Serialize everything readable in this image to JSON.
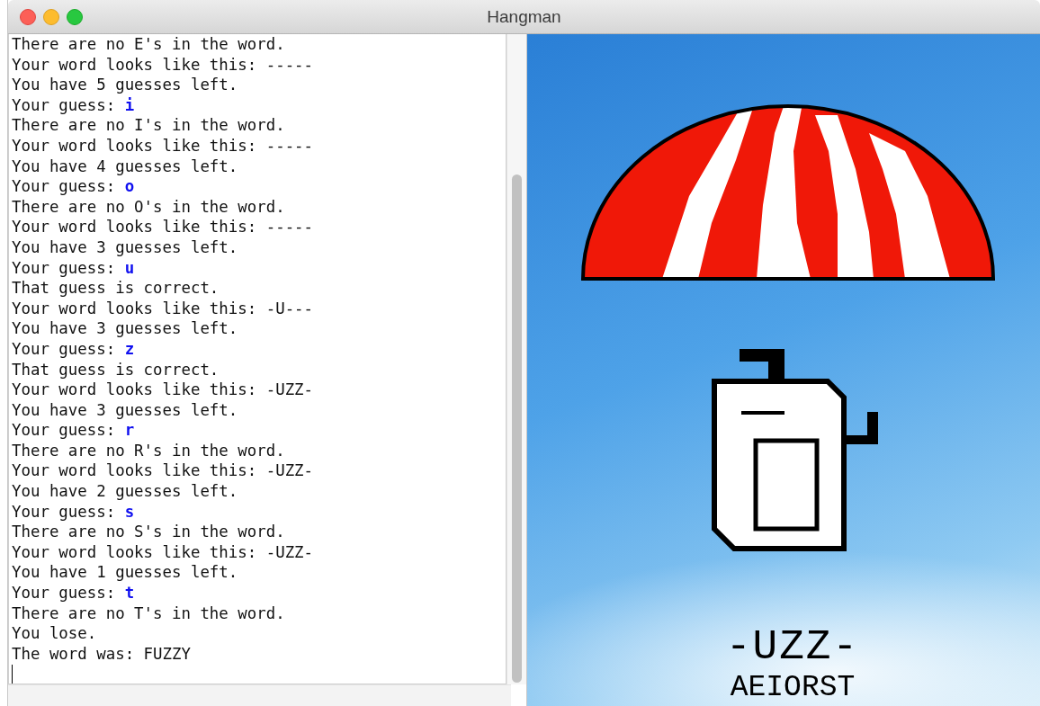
{
  "window": {
    "title": "Hangman"
  },
  "console": {
    "lines": [
      {
        "kind": "text",
        "text": "There are no E's in the word."
      },
      {
        "kind": "text",
        "text": "Your word looks like this: -----"
      },
      {
        "kind": "text",
        "text": "You have 5 guesses left."
      },
      {
        "kind": "guess",
        "prompt": "Your guess:",
        "letter": "i"
      },
      {
        "kind": "text",
        "text": "There are no I's in the word."
      },
      {
        "kind": "text",
        "text": "Your word looks like this: -----"
      },
      {
        "kind": "text",
        "text": "You have 4 guesses left."
      },
      {
        "kind": "guess",
        "prompt": "Your guess:",
        "letter": "o"
      },
      {
        "kind": "text",
        "text": "There are no O's in the word."
      },
      {
        "kind": "text",
        "text": "Your word looks like this: -----"
      },
      {
        "kind": "text",
        "text": "You have 3 guesses left."
      },
      {
        "kind": "guess",
        "prompt": "Your guess:",
        "letter": "u"
      },
      {
        "kind": "text",
        "text": "That guess is correct."
      },
      {
        "kind": "text",
        "text": "Your word looks like this: -U---"
      },
      {
        "kind": "text",
        "text": "You have 3 guesses left."
      },
      {
        "kind": "guess",
        "prompt": "Your guess:",
        "letter": "z"
      },
      {
        "kind": "text",
        "text": "That guess is correct."
      },
      {
        "kind": "text",
        "text": "Your word looks like this: -UZZ-"
      },
      {
        "kind": "text",
        "text": "You have 3 guesses left."
      },
      {
        "kind": "guess",
        "prompt": "Your guess:",
        "letter": "r"
      },
      {
        "kind": "text",
        "text": "There are no R's in the word."
      },
      {
        "kind": "text",
        "text": "Your word looks like this: -UZZ-"
      },
      {
        "kind": "text",
        "text": "You have 2 guesses left."
      },
      {
        "kind": "guess",
        "prompt": "Your guess:",
        "letter": "s"
      },
      {
        "kind": "text",
        "text": "There are no S's in the word."
      },
      {
        "kind": "text",
        "text": "Your word looks like this: -UZZ-"
      },
      {
        "kind": "text",
        "text": "You have 1 guesses left."
      },
      {
        "kind": "guess",
        "prompt": "Your guess:",
        "letter": "t"
      },
      {
        "kind": "text",
        "text": "There are no T's in the word."
      },
      {
        "kind": "text",
        "text": "You lose."
      },
      {
        "kind": "text",
        "text": "The word was: FUZZY"
      }
    ]
  },
  "scene": {
    "word": "-UZZ-",
    "guessed": "AEIORST"
  }
}
